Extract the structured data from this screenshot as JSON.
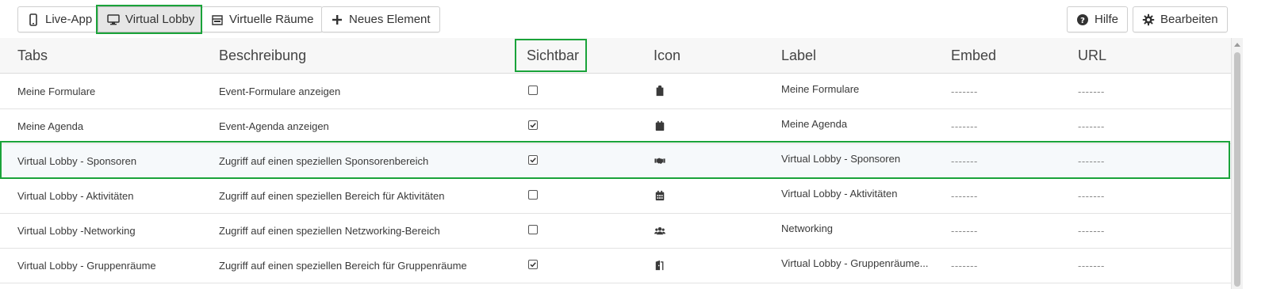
{
  "toolbar": {
    "buttons": [
      {
        "label": "Live-App",
        "icon": "mobile-icon"
      },
      {
        "label": "Virtual Lobby",
        "icon": "desktop-icon",
        "active": true
      },
      {
        "label": "Virtuelle Räume",
        "icon": "building-icon"
      },
      {
        "label": "Neues Element",
        "icon": "plus-icon"
      }
    ],
    "help_label": "Hilfe",
    "edit_label": "Bearbeiten"
  },
  "table": {
    "headers": [
      "Tabs",
      "Beschreibung",
      "Sichtbar",
      "Icon",
      "Label",
      "Embed",
      "URL"
    ],
    "rows": [
      {
        "tab": "Meine Formulare",
        "description": "Event-Formulare anzeigen",
        "visible": false,
        "icon": "clipboard-icon",
        "label": "Meine Formulare",
        "embed": "-------",
        "url": "-------"
      },
      {
        "tab": "Meine Agenda",
        "description": "Event-Agenda anzeigen",
        "visible": true,
        "icon": "calendar-icon",
        "label": "Meine Agenda",
        "embed": "-------",
        "url": "-------"
      },
      {
        "tab": "Virtual Lobby - Sponsoren",
        "description": "Zugriff auf einen speziellen Sponsorenbereich",
        "visible": true,
        "icon": "handshake-icon",
        "label": "Virtual Lobby - Sponsoren",
        "embed": "-------",
        "url": "-------"
      },
      {
        "tab": "Virtual Lobby - Aktivitäten",
        "description": "Zugriff auf einen speziellen Bereich für Aktivitäten",
        "visible": false,
        "icon": "calendar-grid-icon",
        "label": "Virtual Lobby - Aktivitäten",
        "embed": "-------",
        "url": "-------"
      },
      {
        "tab": "Virtual Lobby -Networking",
        "description": "Zugriff auf einen speziellen Netzworking-Bereich",
        "visible": false,
        "icon": "users-icon",
        "label": "Networking",
        "embed": "-------",
        "url": "-------"
      },
      {
        "tab": "Virtual Lobby - Gruppenräume",
        "description": "Zugriff auf einen speziellen Bereich für Gruppenräume",
        "visible": true,
        "icon": "door-open-icon",
        "label": "Virtual Lobby - Gruppenräume...",
        "embed": "-------",
        "url": "-------"
      }
    ]
  },
  "colors": {
    "highlight": "#1aa33a",
    "active_button": "#e6e6e6",
    "header_bg": "#f7f7f7",
    "row_alt_bg": "#f6f9fb"
  }
}
